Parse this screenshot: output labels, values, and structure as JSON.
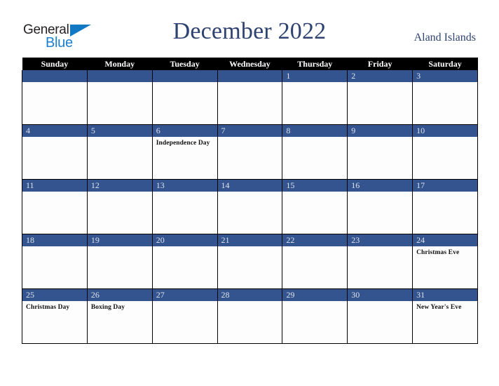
{
  "brand": {
    "name_part1": "General",
    "name_part2": "Blue",
    "triangle_icon": "triangle-icon",
    "blue_hex": "#1b7fd1",
    "dark_hex": "#231f20"
  },
  "header": {
    "title": "December 2022",
    "country": "Aland Islands",
    "title_color": "#2e4372"
  },
  "calendar": {
    "accent_hex": "#33548e",
    "header_bg_hex": "#000000",
    "weekdays": [
      "Sunday",
      "Monday",
      "Tuesday",
      "Wednesday",
      "Thursday",
      "Friday",
      "Saturday"
    ],
    "weeks": [
      [
        {
          "day": "",
          "event": ""
        },
        {
          "day": "",
          "event": ""
        },
        {
          "day": "",
          "event": ""
        },
        {
          "day": "",
          "event": ""
        },
        {
          "day": "1",
          "event": ""
        },
        {
          "day": "2",
          "event": ""
        },
        {
          "day": "3",
          "event": ""
        }
      ],
      [
        {
          "day": "4",
          "event": ""
        },
        {
          "day": "5",
          "event": ""
        },
        {
          "day": "6",
          "event": "Independence Day"
        },
        {
          "day": "7",
          "event": ""
        },
        {
          "day": "8",
          "event": ""
        },
        {
          "day": "9",
          "event": ""
        },
        {
          "day": "10",
          "event": ""
        }
      ],
      [
        {
          "day": "11",
          "event": ""
        },
        {
          "day": "12",
          "event": ""
        },
        {
          "day": "13",
          "event": ""
        },
        {
          "day": "14",
          "event": ""
        },
        {
          "day": "15",
          "event": ""
        },
        {
          "day": "16",
          "event": ""
        },
        {
          "day": "17",
          "event": ""
        }
      ],
      [
        {
          "day": "18",
          "event": ""
        },
        {
          "day": "19",
          "event": ""
        },
        {
          "day": "20",
          "event": ""
        },
        {
          "day": "21",
          "event": ""
        },
        {
          "day": "22",
          "event": ""
        },
        {
          "day": "23",
          "event": ""
        },
        {
          "day": "24",
          "event": "Christmas Eve"
        }
      ],
      [
        {
          "day": "25",
          "event": "Christmas Day"
        },
        {
          "day": "26",
          "event": "Boxing Day"
        },
        {
          "day": "27",
          "event": ""
        },
        {
          "day": "28",
          "event": ""
        },
        {
          "day": "29",
          "event": ""
        },
        {
          "day": "30",
          "event": ""
        },
        {
          "day": "31",
          "event": "New Year's Eve"
        }
      ]
    ]
  }
}
